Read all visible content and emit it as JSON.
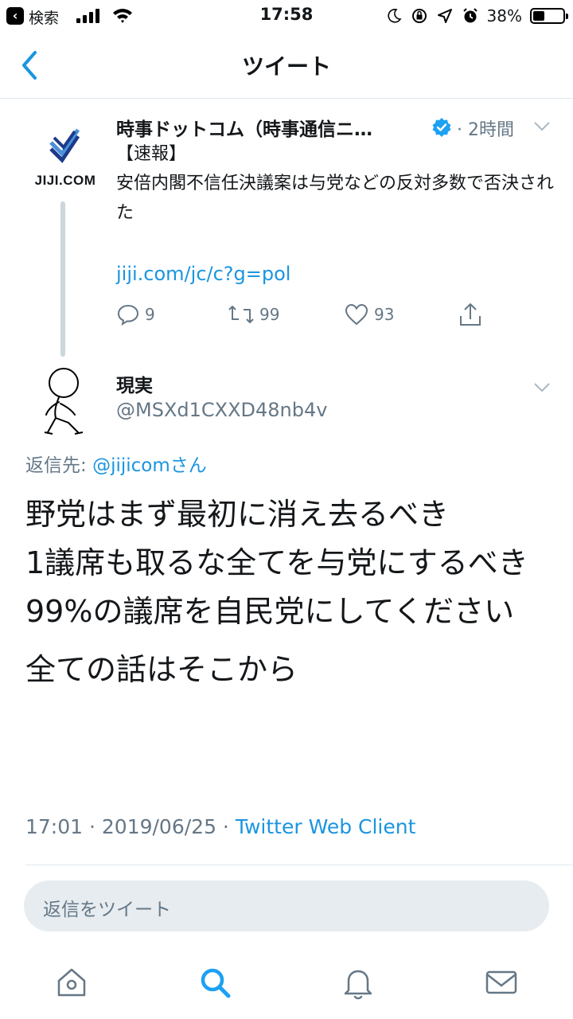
{
  "status_bar": {
    "back_app": "検索",
    "time": "17:58",
    "battery": "38%",
    "battery_level": 0.38
  },
  "nav": {
    "title": "ツイート"
  },
  "parent_tweet": {
    "logo_text": "JIJI.COM",
    "author_name": "時事ドットコム（時事通信ニ…",
    "time_ago": "· 2時間",
    "body": "【速報】\n安倍内閣不信任決議案は与党などの反対多数で否決された",
    "link": "jiji.com/jc/c?g=pol",
    "replies": "9",
    "retweets": "99",
    "likes": "93",
    "accent": "#1b95e0"
  },
  "reply_tweet": {
    "author_name": "現実",
    "handle": "@MSXd1CXXD48nb4v",
    "reply_to_label": "返信先: ",
    "reply_to_mention": "@jijicomさん",
    "lines": [
      "野党はまず最初に消え去るべき",
      "1議席も取るな全てを与党にするべき",
      "99%の議席を自民党にしてください",
      "全ての話はそこから"
    ],
    "timestamp": "17:01 · 2019/06/25 · ",
    "client": "Twitter Web Client"
  },
  "compose": {
    "placeholder": "返信をツイート"
  },
  "tabs": [
    {
      "icon": "home-icon"
    },
    {
      "icon": "search-icon",
      "active": true
    },
    {
      "icon": "notifications-bell-icon"
    },
    {
      "icon": "messages-envelope-icon"
    }
  ],
  "colors": {
    "link": "#1b95e0",
    "muted": "#657786",
    "divider": "#e1e8ed"
  }
}
